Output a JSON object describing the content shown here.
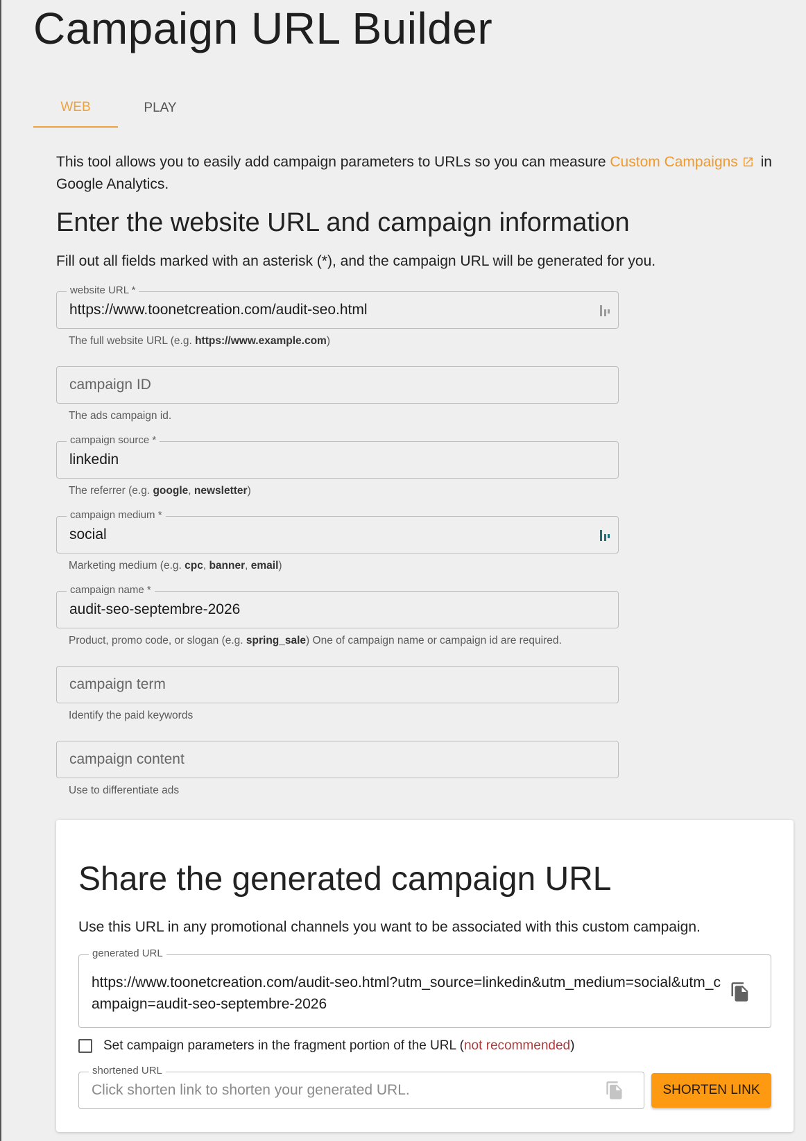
{
  "page_title": "Campaign URL Builder",
  "tabs": [
    {
      "label": "WEB",
      "active": true
    },
    {
      "label": "PLAY",
      "active": false
    }
  ],
  "intro": {
    "text_before": "This tool allows you to easily add campaign parameters to URLs so you can measure ",
    "link_text": "Custom Campaigns",
    "text_after": " in Google Analytics."
  },
  "form": {
    "title": "Enter the website URL and campaign information",
    "description": "Fill out all fields marked with an asterisk (*), and the campaign URL will be generated for you.",
    "website_url": {
      "label": "website URL *",
      "value": "https://www.toonetcreation.com/audit-seo.html",
      "helper_prefix": "The full website URL (e.g. ",
      "helper_bold": "https://www.example.com",
      "helper_suffix": ")"
    },
    "campaign_id": {
      "placeholder": "campaign ID",
      "helper": "The ads campaign id."
    },
    "campaign_source": {
      "label": "campaign source *",
      "value": "linkedin",
      "helper_prefix": "The referrer (e.g. ",
      "helper_bold_1": "google",
      "helper_sep": ", ",
      "helper_bold_2": "newsletter",
      "helper_suffix": ")"
    },
    "campaign_medium": {
      "label": "campaign medium *",
      "value": "social",
      "helper_prefix": "Marketing medium (e.g. ",
      "helper_bold_1": "cpc",
      "helper_sep_1": ", ",
      "helper_bold_2": "banner",
      "helper_sep_2": ", ",
      "helper_bold_3": "email",
      "helper_suffix": ")"
    },
    "campaign_name": {
      "label": "campaign name *",
      "value": "audit-seo-septembre-2026",
      "helper_prefix": "Product, promo code, or slogan (e.g. ",
      "helper_bold": "spring_sale",
      "helper_suffix": ") One of campaign name or campaign id are required."
    },
    "campaign_term": {
      "placeholder": "campaign term",
      "helper": "Identify the paid keywords"
    },
    "campaign_content": {
      "placeholder": "campaign content",
      "helper": "Use to differentiate ads"
    }
  },
  "share": {
    "title": "Share the generated campaign URL",
    "description": "Use this URL in any promotional channels you want to be associated with this custom campaign.",
    "generated_url_label": "generated URL",
    "generated_url": "https://www.toonetcreation.com/audit-seo.html?utm_source=linkedin&utm_medium=social&utm_campaign=audit-seo-septembre-2026",
    "fragment_checkbox_text": "Set campaign parameters in the fragment portion of the URL (",
    "fragment_not_recommended": "not recommended",
    "fragment_suffix": ")",
    "fragment_checked": false,
    "shortened_url_label": "shortened URL",
    "shortened_url_placeholder": "Click shorten link to shorten your generated URL.",
    "shorten_button": "SHORTEN LINK"
  },
  "colors": {
    "accent": "#f0a33a",
    "button": "#fd9a12",
    "warning_text": "#b03a3a"
  }
}
